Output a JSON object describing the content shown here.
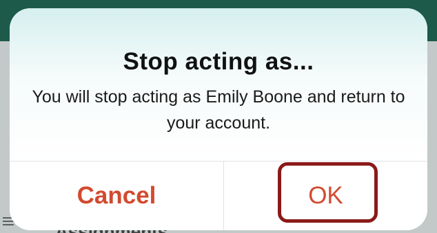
{
  "background": {
    "partial_label": "Assignments"
  },
  "alert": {
    "title": "Stop acting as...",
    "message": "You will stop acting as Emily Boone and return to your account.",
    "cancel_label": "Cancel",
    "ok_label": "OK"
  },
  "colors": {
    "button_text": "#d24a30",
    "highlight_border": "#8a1a1a",
    "topbar": "#1d5a4a"
  },
  "icons": [
    "list-icon"
  ]
}
